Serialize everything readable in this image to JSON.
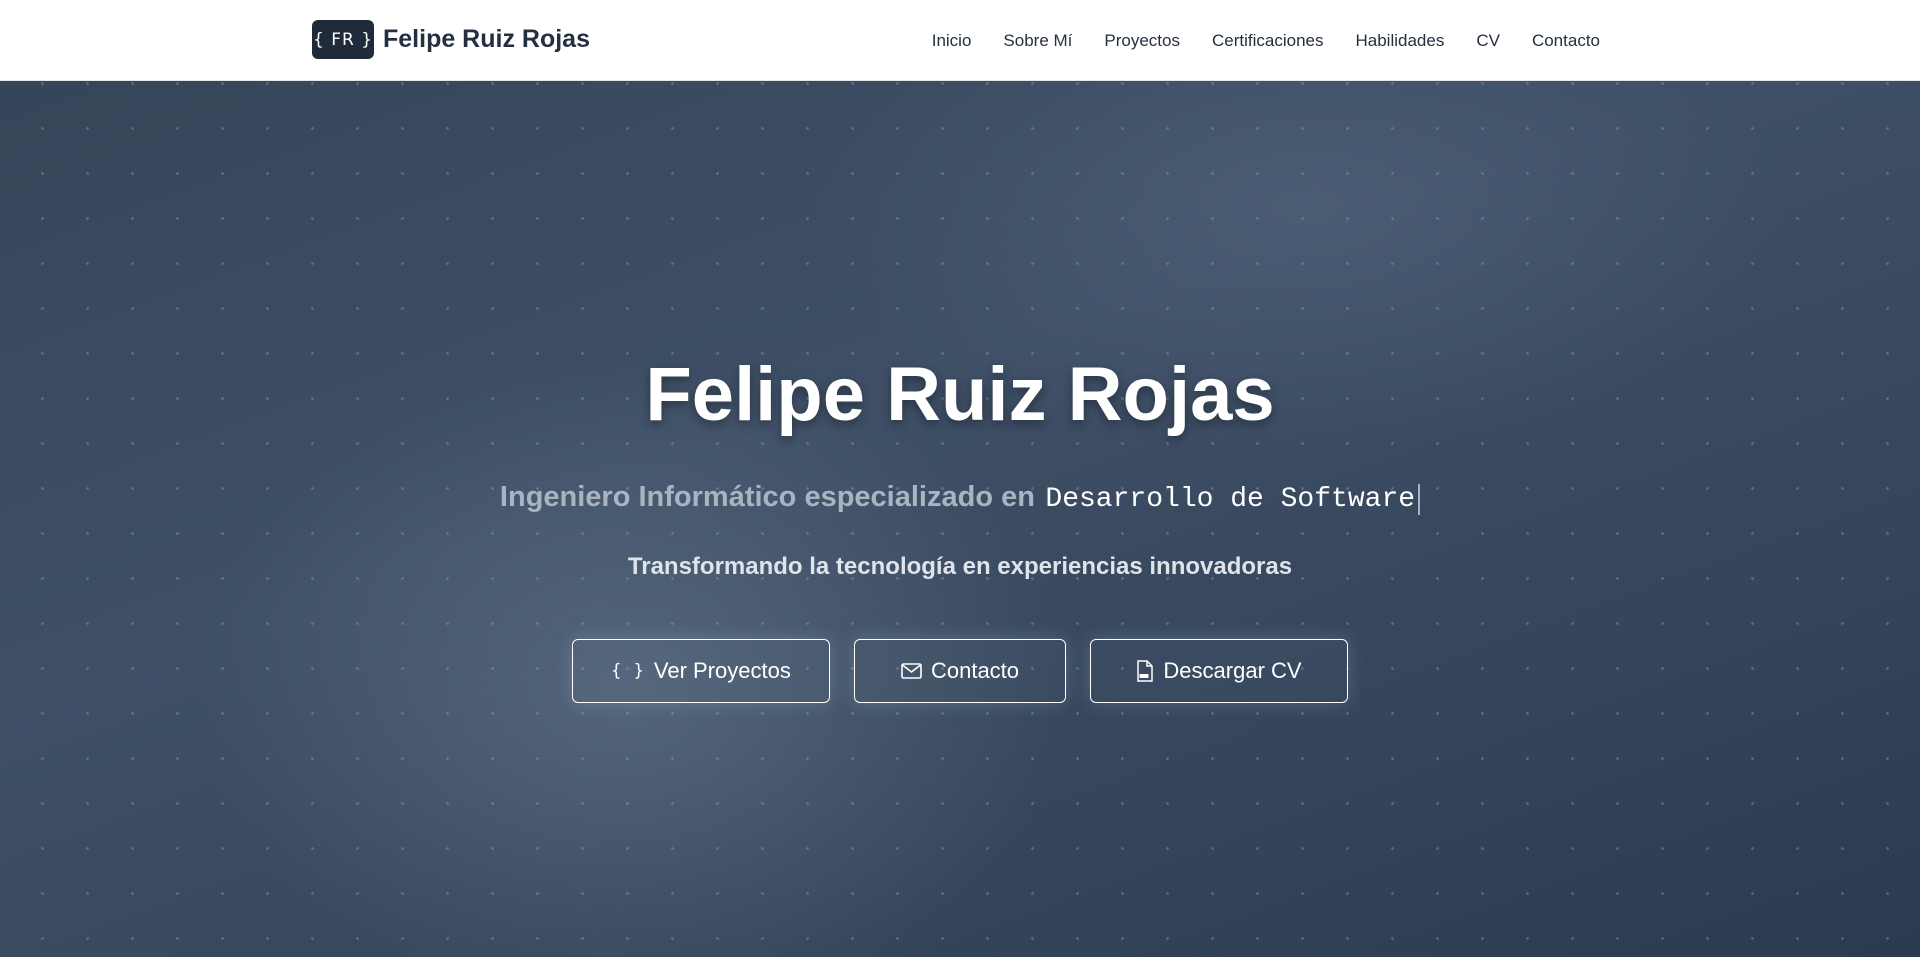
{
  "brand": {
    "logo_text": "{ FR }",
    "name": "Felipe Ruiz Rojas"
  },
  "nav": {
    "items": [
      {
        "label": "Inicio"
      },
      {
        "label": "Sobre Mí"
      },
      {
        "label": "Proyectos"
      },
      {
        "label": "Certificaciones"
      },
      {
        "label": "Habilidades"
      },
      {
        "label": "CV"
      },
      {
        "label": "Contacto"
      }
    ]
  },
  "hero": {
    "title": "Felipe Ruiz Rojas",
    "subtitle_prefix": "Ingeniero Informático especializado en",
    "subtitle_typed": "Desarrollo de Software",
    "tagline": "Transformando la tecnología en experiencias innovadoras",
    "buttons": {
      "projects": {
        "label": "Ver Proyectos",
        "icon": "code-braces-icon",
        "glyph": "{ }"
      },
      "contact": {
        "label": "Contacto",
        "icon": "envelope-icon"
      },
      "cv": {
        "label": "Descargar CV",
        "icon": "pdf-file-icon"
      }
    }
  },
  "colors": {
    "navbar_bg": "#ffffff",
    "logo_bg": "#1f2a3b",
    "hero_bg": "#3a4a60",
    "text_primary": "#ffffff",
    "subtitle_muted": "#aab4c1"
  }
}
